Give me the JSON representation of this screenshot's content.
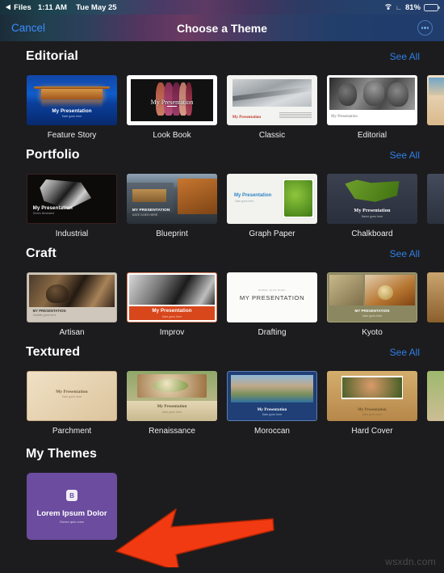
{
  "status_bar": {
    "back_app": "Files",
    "back_icon": "triangle-left-icon",
    "time": "1:11 AM",
    "date": "Tue May 25",
    "wifi_icon": "wifi-icon",
    "location_icon": "location-icon",
    "battery_percent": "81%",
    "battery_icon": "battery-icon"
  },
  "nav": {
    "cancel_label": "Cancel",
    "title": "Choose a Theme",
    "more_icon": "ellipsis-circle-icon"
  },
  "sections": [
    {
      "title": "Editorial",
      "see_all": "See All",
      "themes": [
        {
          "name": "Feature Story",
          "slide_title": "My Presentation",
          "slide_sub": "Date goes here"
        },
        {
          "name": "Look Book",
          "slide_title": "My Presentation",
          "slide_sub": ""
        },
        {
          "name": "Classic",
          "slide_title": "My Presentation",
          "slide_sub": ""
        },
        {
          "name": "Editorial",
          "slide_title": "My Presentation",
          "slide_sub": ""
        }
      ]
    },
    {
      "title": "Portfolio",
      "see_all": "See All",
      "themes": [
        {
          "name": "Industrial",
          "slide_title": "My Presentation",
          "slide_sub": "Series illustrated"
        },
        {
          "name": "Blueprint",
          "slide_title": "MY PRESENTATION",
          "slide_sub": "DATE GOES HERE"
        },
        {
          "name": "Graph Paper",
          "slide_title": "My Presentation",
          "slide_sub": "Date goes here"
        },
        {
          "name": "Chalkboard",
          "slide_title": "My Presentation",
          "slide_sub": "Name goes here"
        }
      ]
    },
    {
      "title": "Craft",
      "see_all": "See All",
      "themes": [
        {
          "name": "Artisan",
          "slide_title": "MY PRESENTATION",
          "slide_sub": "Subtitle goes here"
        },
        {
          "name": "Improv",
          "slide_title": "My Presentation",
          "slide_sub": "Date goes here"
        },
        {
          "name": "Drafting",
          "slide_title": "MY PRESENTATION",
          "slide_sub": "DONEC QUIS NUNC"
        },
        {
          "name": "Kyoto",
          "slide_title": "MY PRESENTATION",
          "slide_sub": "Date goes here"
        }
      ]
    },
    {
      "title": "Textured",
      "see_all": "See All",
      "themes": [
        {
          "name": "Parchment",
          "slide_title": "My Presentation",
          "slide_sub": "Date goes here"
        },
        {
          "name": "Renaissance",
          "slide_title": "My Presentation",
          "slide_sub": "Date goes here"
        },
        {
          "name": "Moroccan",
          "slide_title": "My Presentation",
          "slide_sub": "Date goes here"
        },
        {
          "name": "Hard Cover",
          "slide_title": "My Presentation",
          "slide_sub": "Date goes here"
        }
      ]
    }
  ],
  "my_themes": {
    "title": "My Themes",
    "items": [
      {
        "badge": "B",
        "title": "Lorem Ipsum Dolor",
        "subtitle": "Donec quis nunc"
      }
    ]
  },
  "annotation": {
    "arrow_icon": "red-left-arrow-annotation",
    "arrow_color": "#F23A12"
  },
  "watermark": "wsxdn.com",
  "colors": {
    "background": "#1C1C1E",
    "accent_link": "#2F7FE8",
    "cancel_link": "#3B8CFF",
    "my_theme_card": "#6B4C9E"
  }
}
